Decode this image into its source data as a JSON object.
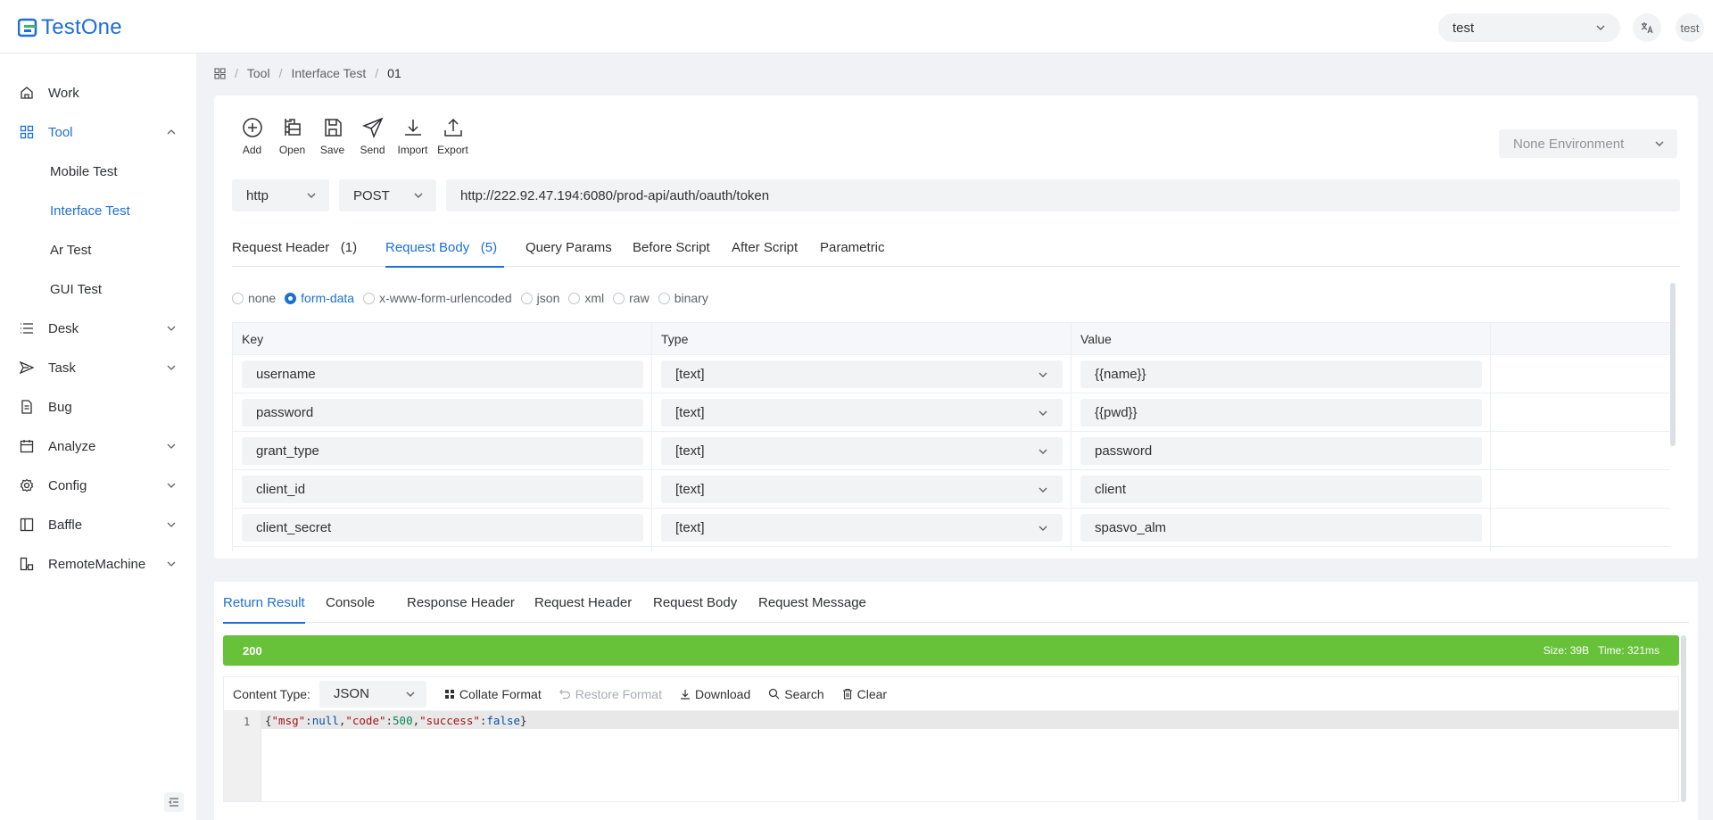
{
  "app": {
    "name": "TestOne",
    "brand_color": "#1d6fd6"
  },
  "header": {
    "project": "test",
    "translate_icon": "translate-icon",
    "user": "test"
  },
  "sidebar": {
    "items": [
      {
        "label": "Work",
        "icon": "home-icon"
      },
      {
        "label": "Tool",
        "icon": "grid-icon"
      },
      {
        "label": "Desk",
        "icon": "list-icon"
      },
      {
        "label": "Task",
        "icon": "send-icon"
      },
      {
        "label": "Bug",
        "icon": "document-icon"
      },
      {
        "label": "Analyze",
        "icon": "calendar-icon"
      },
      {
        "label": "Config",
        "icon": "gear-icon"
      },
      {
        "label": "Baffle",
        "icon": "panel-icon"
      },
      {
        "label": "RemoteMachine",
        "icon": "hierarchy-icon"
      }
    ],
    "tool_children": [
      "Mobile Test",
      "Interface Test",
      "Ar Test",
      "GUI Test"
    ]
  },
  "breadcrumb": {
    "items": [
      "Tool",
      "Interface Test",
      "01"
    ]
  },
  "toolbar": {
    "add": "Add",
    "open": "Open",
    "save": "Save",
    "send": "Send",
    "import": "Import",
    "export": "Export"
  },
  "environment": {
    "value": "None Environment"
  },
  "request": {
    "protocol": "http",
    "method": "POST",
    "url": "http://222.92.47.194:6080/prod-api/auth/oauth/token"
  },
  "tabs": [
    {
      "label": "Request Header",
      "count": "(1)"
    },
    {
      "label": "Request Body",
      "count": "(5)"
    },
    {
      "label": "Query Params"
    },
    {
      "label": "Before Script"
    },
    {
      "label": "After Script"
    },
    {
      "label": "Parametric"
    }
  ],
  "body_types": [
    "none",
    "form-data",
    "x-www-form-urlencoded",
    "json",
    "xml",
    "raw",
    "binary"
  ],
  "body_type_selected": "form-data",
  "form_table": {
    "headers": [
      "Key",
      "Type",
      "Value"
    ],
    "rows": [
      {
        "key": "username",
        "type": "[text]",
        "value": "{{name}}"
      },
      {
        "key": "password",
        "type": "[text]",
        "value": "{{pwd}}"
      },
      {
        "key": "grant_type",
        "type": "[text]",
        "value": "password"
      },
      {
        "key": "client_id",
        "type": "[text]",
        "value": "client"
      },
      {
        "key": "client_secret",
        "type": "[text]",
        "value": "spasvo_alm"
      }
    ]
  },
  "result_tabs": [
    "Return Result",
    "Console",
    "Response Header",
    "Request Header",
    "Request Body",
    "Request Message"
  ],
  "response": {
    "status": "200",
    "size": "Size: 39B",
    "time": "Time: 321ms",
    "status_color": "#67c23a",
    "content_type_label": "Content Type:",
    "content_type": "JSON",
    "actions": {
      "collate": "Collate Format",
      "restore": "Restore Format",
      "download": "Download",
      "search": "Search",
      "clear": "Clear"
    },
    "line_number": "1",
    "body": "{\"msg\":null,\"code\":500,\"success\":false}"
  }
}
